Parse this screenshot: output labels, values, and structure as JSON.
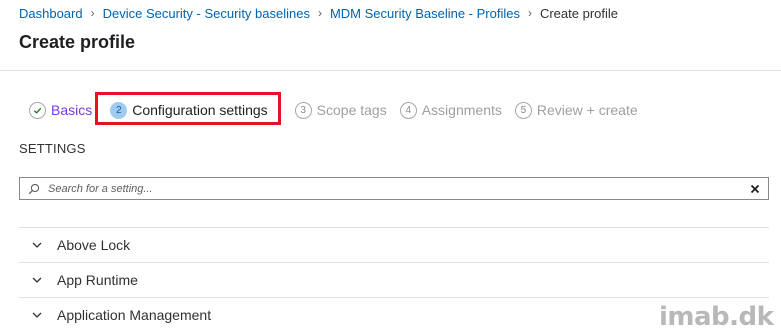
{
  "breadcrumb": {
    "items": [
      "Dashboard",
      "Device Security - Security baselines",
      "MDM Security Baseline - Profiles"
    ],
    "current": "Create profile"
  },
  "page": {
    "title": "Create profile"
  },
  "wizard": {
    "steps": [
      {
        "number": "",
        "label": "Basics",
        "state": "done"
      },
      {
        "number": "2",
        "label": "Configuration settings",
        "state": "active"
      },
      {
        "number": "3",
        "label": "Scope tags",
        "state": "pending"
      },
      {
        "number": "4",
        "label": "Assignments",
        "state": "pending"
      },
      {
        "number": "5",
        "label": "Review + create",
        "state": "pending"
      }
    ],
    "done_icon": "checkmark-icon"
  },
  "settings": {
    "heading": "SETTINGS",
    "search_placeholder": "Search for a setting...",
    "search_value": "",
    "groups": [
      {
        "label": "Above Lock"
      },
      {
        "label": "App Runtime"
      },
      {
        "label": "Application Management"
      }
    ]
  },
  "watermark": "imab.dk",
  "colors": {
    "link": "#0063b1",
    "done_step": "#773adc",
    "active_step_circle": "#a0cbee",
    "highlight": "#e81123",
    "check": "#107c10"
  }
}
